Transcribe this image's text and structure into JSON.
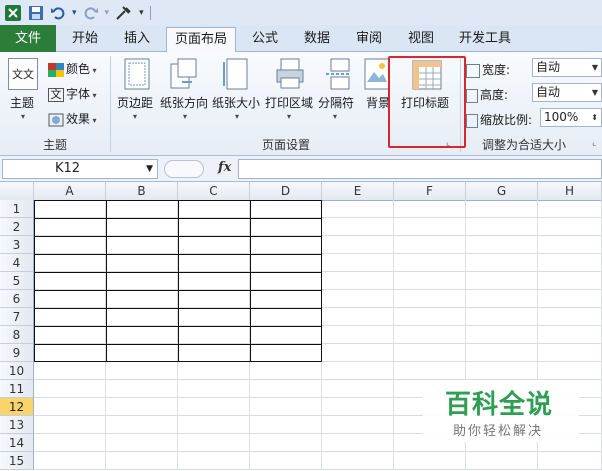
{
  "quick_access": {
    "icons": [
      "excel-logo-icon",
      "save-icon",
      "undo-icon",
      "redo-icon",
      "customize-icon"
    ],
    "undo_caret": "▾",
    "redo_caret": "▾",
    "menu_caret": "▾"
  },
  "tabs": [
    {
      "label": "文件"
    },
    {
      "label": "开始"
    },
    {
      "label": "插入"
    },
    {
      "label": "页面布局"
    },
    {
      "label": "公式"
    },
    {
      "label": "数据"
    },
    {
      "label": "审阅"
    },
    {
      "label": "视图"
    },
    {
      "label": "开发工具"
    }
  ],
  "ribbon": {
    "theme_group": {
      "label": "主题",
      "theme_button": "主题",
      "colors": "颜色",
      "fonts": "字体",
      "effects": "效果",
      "icon_text": "文文"
    },
    "page_setup_group": {
      "label": "页面设置",
      "margins": "页边距",
      "orientation": "纸张方向",
      "size": "纸张大小",
      "print_area": "打印区域",
      "breaks": "分隔符",
      "background": "背景",
      "print_titles": "打印标题"
    },
    "scale_group": {
      "label": "调整为合适大小",
      "width_label": "宽度:",
      "width_value": "自动",
      "height_label": "高度:",
      "height_value": "自动",
      "scale_label": "缩放比例:",
      "scale_value": "100%"
    }
  },
  "formula_bar": {
    "name_box": "K12",
    "fx": "fx",
    "formula": ""
  },
  "grid": {
    "columns": [
      "A",
      "B",
      "C",
      "D",
      "E",
      "F",
      "G",
      "H"
    ],
    "rows": [
      "1",
      "2",
      "3",
      "4",
      "5",
      "6",
      "7",
      "8",
      "9",
      "10",
      "11",
      "12",
      "13",
      "14",
      "15"
    ],
    "selected_row": "12"
  },
  "watermark": {
    "title": "百科全说",
    "subtitle": "助你轻松解决"
  },
  "colors": {
    "file_tab": "#2c7d3a",
    "highlight_box": "#d9272e",
    "watermark_green": "#2e9e52",
    "selected_row_header": "#f8d46a"
  }
}
